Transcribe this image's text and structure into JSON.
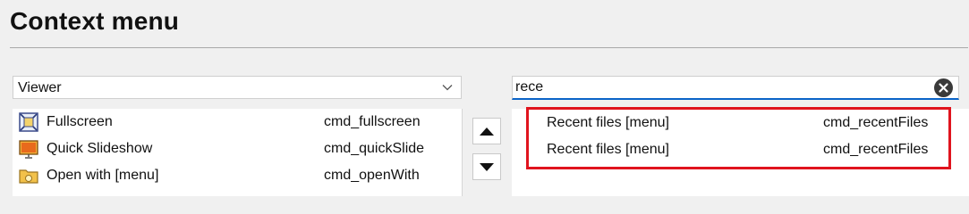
{
  "page": {
    "title": "Context menu"
  },
  "dropdown": {
    "value": "Viewer"
  },
  "search": {
    "value": "rece"
  },
  "left_list": {
    "items": [
      {
        "label": "Fullscreen",
        "command": "cmd_fullscreen",
        "icon": "fullscreen-icon"
      },
      {
        "label": "Quick Slideshow",
        "command": "cmd_quickSlide",
        "icon": "slideshow-icon"
      },
      {
        "label": "Open with [menu]",
        "command": "cmd_openWith",
        "icon": "folder-icon"
      }
    ]
  },
  "right_list": {
    "items": [
      {
        "label": "Recent files [menu]",
        "command": "cmd_recentFiles"
      },
      {
        "label": "Recent files [menu]",
        "command": "cmd_recentFiles"
      }
    ]
  },
  "colors": {
    "highlight": "#e0141e",
    "focus": "#0a64c8"
  }
}
